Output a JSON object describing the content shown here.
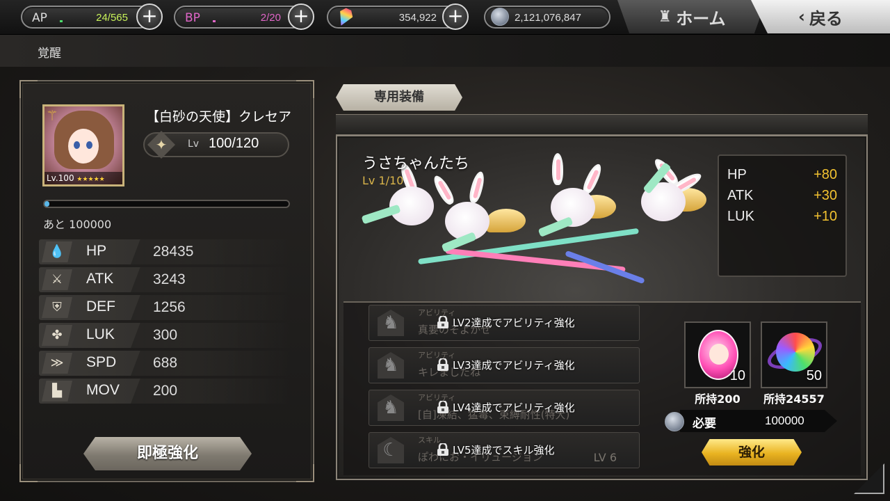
{
  "topbar": {
    "ap": {
      "label": "AP",
      "value": "24/565",
      "color": "#c8f25a"
    },
    "bp": {
      "label": "BP",
      "value": "2/20",
      "color": "#e066c8"
    },
    "gems": {
      "icon": "gem-icon",
      "value": "354,922"
    },
    "coins": {
      "icon": "coin-icon",
      "value": "2,121,076,847"
    },
    "home_label": "ホーム",
    "back_label": "戻る"
  },
  "page_title": "覚醒",
  "character": {
    "name": "【白砂の天使】クレセア",
    "portrait_level": "Lv.100",
    "stars": "★★★★★",
    "lv_label": "Lv",
    "lv_value": "100/120",
    "exp_text": "あと 100000",
    "exp_fill": 0.02
  },
  "stats": [
    {
      "name": "HP",
      "value": "28435",
      "icon": "drop-icon",
      "glyph": "💧"
    },
    {
      "name": "ATK",
      "value": "3243",
      "icon": "sword-icon",
      "glyph": "⚔"
    },
    {
      "name": "DEF",
      "value": "1256",
      "icon": "shield-icon",
      "glyph": "⛨"
    },
    {
      "name": "LUK",
      "value": "300",
      "icon": "clover-icon",
      "glyph": "✤"
    },
    {
      "name": "SPD",
      "value": "688",
      "icon": "speed-icon",
      "glyph": "≫"
    },
    {
      "name": "MOV",
      "value": "200",
      "icon": "boot-icon",
      "glyph": "▙"
    }
  ],
  "limit_break_label": "即極強化",
  "equipment": {
    "tab_label": "専用装備",
    "name": "うさちゃんたち",
    "level": "Lv 1/10",
    "bonuses": [
      {
        "name": "HP",
        "value": "+80"
      },
      {
        "name": "ATK",
        "value": "+30"
      },
      {
        "name": "LUK",
        "value": "+10"
      }
    ]
  },
  "abilities": [
    {
      "type": "アビリティ",
      "ghost": "真要のそよかせ",
      "lock_text": "LV2達成でアビリティ強化"
    },
    {
      "type": "アビリティ",
      "ghost": "キレましたね",
      "lock_text": "LV3達成でアビリティ強化"
    },
    {
      "type": "アビリティ",
      "ghost": "[自]凍結、猛毒、束縛耐性(特大)",
      "lock_text": "LV4達成でアビリティ強化"
    },
    {
      "type": "スキル",
      "ghost": "ぽわにお・イリュージョン",
      "lock_text": "LV5達成でスキル強化",
      "skill_lv": "LV 6"
    }
  ],
  "materials": [
    {
      "icon": "pink-gem-icon",
      "count": "10",
      "owned": "所持200"
    },
    {
      "icon": "rainbow-orb-icon",
      "count": "50",
      "owned": "所持24557"
    }
  ],
  "cost": {
    "label": "必要",
    "value": "100000"
  },
  "enhance_label": "強化"
}
